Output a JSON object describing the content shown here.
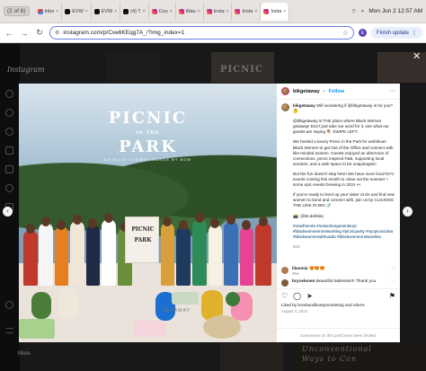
{
  "browser": {
    "page_badge": "(2 of 6)",
    "tabs": [
      {
        "icon": "gmail",
        "label": "Inbo",
        "active": false
      },
      {
        "icon": "x",
        "label": "EVW",
        "active": false
      },
      {
        "icon": "x",
        "label": "EVW",
        "active": false
      },
      {
        "icon": "x",
        "label": "(4) T",
        "active": false
      },
      {
        "icon": "ig",
        "label": "Cou",
        "active": false
      },
      {
        "icon": "ig",
        "label": "Wau",
        "active": false
      },
      {
        "icon": "ig",
        "label": "Insta",
        "active": false
      },
      {
        "icon": "ig",
        "label": "Insta",
        "active": false
      },
      {
        "icon": "ig",
        "label": "Insta",
        "active": true
      }
    ],
    "clock": "Mon Jun 2  12:57 AM",
    "url": "instagram.com/p/Cve6KEqg7A_/?img_index=1",
    "profile_initial": "E",
    "finish_update": "Finish update"
  },
  "instagram": {
    "logo": "Instagram",
    "more_label": "More",
    "bg_texts": [
      "PICNIC",
      "Unconventional",
      "Ways to Con"
    ]
  },
  "post": {
    "image": {
      "title_line1": "PICNIC",
      "title_line2": "IN THE",
      "title_line3": "PARK",
      "subtitle": "AN ELITE LADIES LOUNGE BY BGW",
      "sign_line1": "PICNIC",
      "sign_line2": "PARK",
      "watermark": "GETAWAY"
    },
    "username": "bikgetaway",
    "follow_sep": "•",
    "follow_label": "Follow",
    "caption": {
      "intro_user": "bikgetaway",
      "intro": "Still wondering if @blkgetaway is for you? 🤔",
      "para1": "@blkgetaway is THE place where Black Women getaway! Don't just take our word for it, see what our guests are saying 👇🏽 SWIPE LEFT.",
      "para2": "We hosted a luxury Picnic in the Park for ambitious Black Women to get Out of the Office and connect with like-minded women. Guests enjoyed an afternoon of connections, picnic inspired F&B, supporting local vendors, and a safe space to be unapologetic.",
      "para3": "But the fun doesn't stop here! We have more local NYC events coming this month to close out the summer + some epic events brewing in 2024 👀",
      "para4": "If you're ready to level up your sister circle and find new women to bond and connect with, join us by CLICKING THE LINK IN BIO 🔗",
      "credit": "📸: @its.debbiej",
      "hashtags": "#newfriends #networkingeventsnyc #blackwomeninnetworking #picnicparty #nycpicnicidea #blackwomenwithoutdo #blackwomennetworkito",
      "time": "95w"
    },
    "comments": [
      {
        "user": "lilasmia",
        "text": "😍😍😍",
        "meta": "95w"
      },
      {
        "user": "brycelonen",
        "text": "Beautiful ladiesss!!!! Thank you",
        "meta": "95w  Reply"
      }
    ],
    "liked_by": "Liked by bombandbossymarketing and others",
    "date": "August 3, 2023",
    "comments_limited": "Comments on this post have been limited."
  },
  "colors": {
    "accent_blue": "#0095f6",
    "omnibox_border": "#6b7fe0",
    "link_dark": "#00376b"
  }
}
